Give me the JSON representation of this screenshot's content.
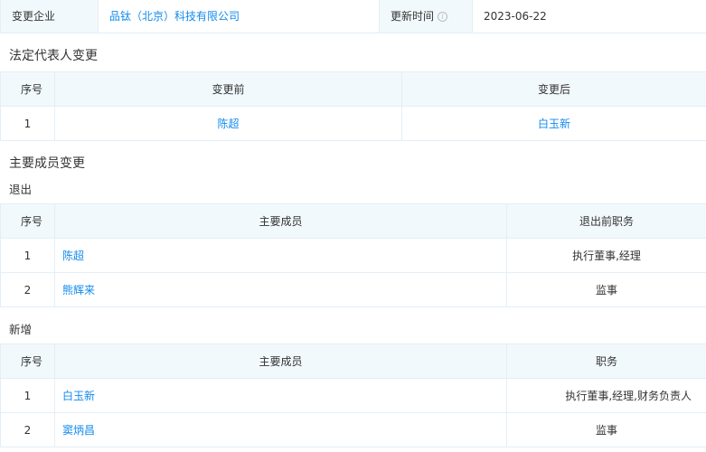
{
  "info": {
    "company_label": "变更企业",
    "company_value": "品钛（北京）科技有限公司",
    "update_label": "更新时间",
    "update_value": "2023-06-22"
  },
  "legal_rep": {
    "title": "法定代表人变更",
    "headers": {
      "seq": "序号",
      "before": "变更前",
      "after": "变更后"
    },
    "rows": [
      {
        "seq": "1",
        "before": "陈超",
        "after": "白玉新"
      }
    ]
  },
  "members": {
    "title": "主要成员变更",
    "exit": {
      "title": "退出",
      "headers": {
        "seq": "序号",
        "member": "主要成员",
        "position": "退出前职务"
      },
      "rows": [
        {
          "seq": "1",
          "member": "陈超",
          "position": "执行董事,经理"
        },
        {
          "seq": "2",
          "member": "熊辉来",
          "position": "监事"
        }
      ]
    },
    "added": {
      "title": "新增",
      "headers": {
        "seq": "序号",
        "member": "主要成员",
        "position": "职务"
      },
      "rows": [
        {
          "seq": "1",
          "member": "白玉新",
          "position": "执行董事,经理,财务负责人"
        },
        {
          "seq": "2",
          "member": "窦炳昌",
          "position": "监事"
        }
      ]
    }
  }
}
